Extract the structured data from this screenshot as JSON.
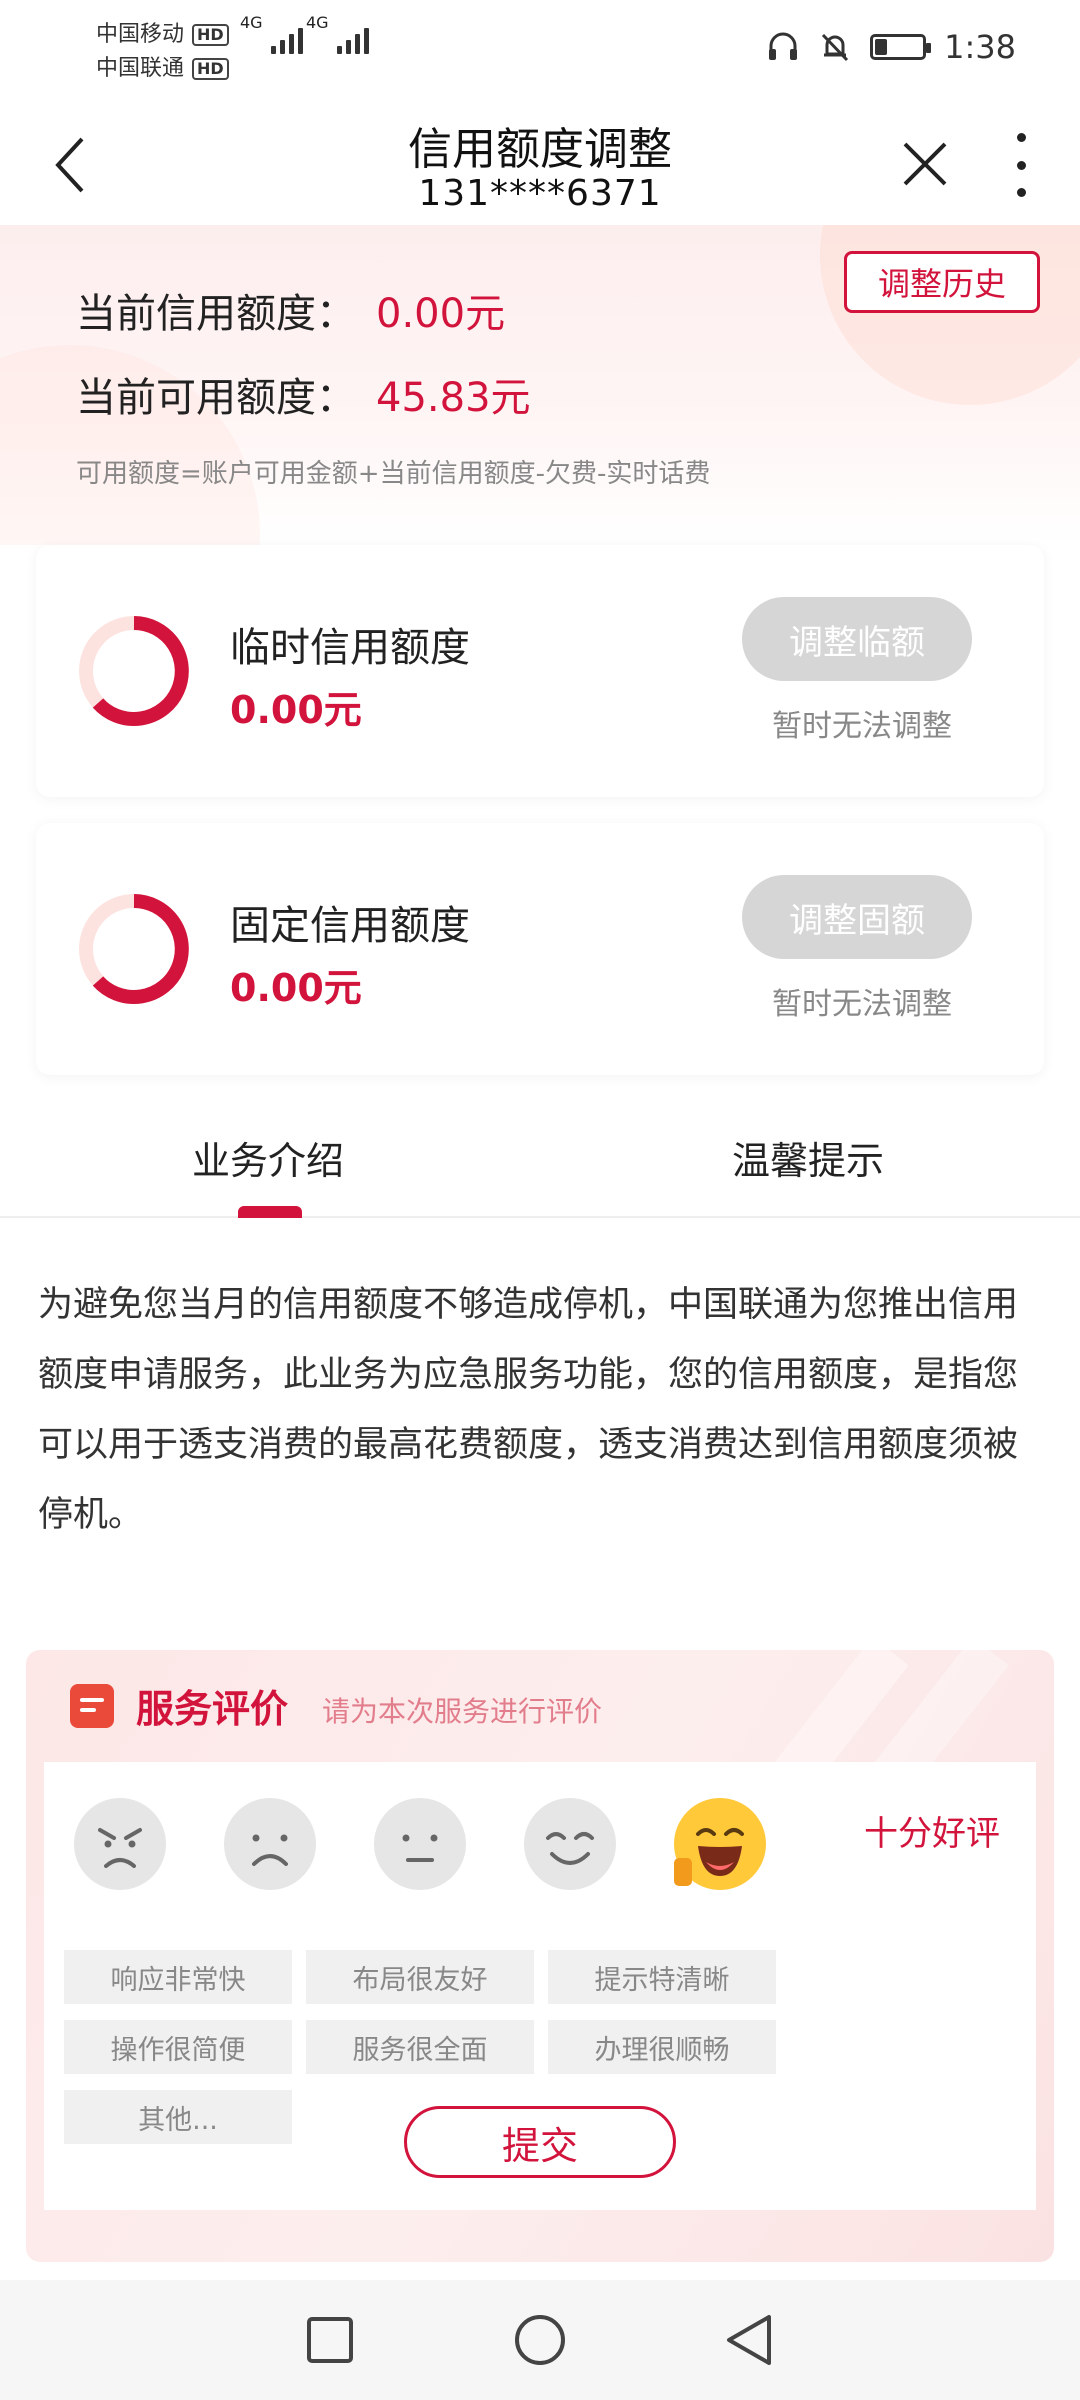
{
  "status_bar": {
    "carrier1": "中国移动",
    "carrier2": "中国联通",
    "hd": "HD",
    "net1": "4G",
    "net2": "4G",
    "time": "1:38",
    "battery_level": 0.25
  },
  "header": {
    "title": "信用额度调整",
    "phone": "131****6371"
  },
  "summary": {
    "history_button": "调整历史",
    "current_credit_label": "当前信用额度：",
    "current_credit_value": "0.00元",
    "current_available_label": "当前可用额度：",
    "current_available_value": "45.83元",
    "formula": "可用额度=账户可用金额+当前信用额度-欠费-实时话费"
  },
  "cards": [
    {
      "label": "临时信用额度",
      "value": "0.00元",
      "button": "调整临额",
      "note": "暂时无法调整"
    },
    {
      "label": "固定信用额度",
      "value": "0.00元",
      "button": "调整固额",
      "note": "暂时无法调整"
    }
  ],
  "tabs": [
    {
      "label": "业务介绍",
      "active": true
    },
    {
      "label": "温馨提示",
      "active": false
    }
  ],
  "intro_text": "为避免您当月的信用额度不够造成停机，中国联通为您推出信用额度申请服务，此业务为应急服务功能，您的信用额度，是指您可以用于透支消费的最高花费额度，透支消费达到信用额度须被停机。",
  "evaluation": {
    "title": "服务评价",
    "hint": "请为本次服务进行评价",
    "selected_rating": 5,
    "rating_text": "十分好评",
    "faces": [
      "angry-face-icon",
      "sad-face-icon",
      "neutral-face-icon",
      "smile-face-icon",
      "laughing-thumbs-up-face-icon"
    ],
    "tags": [
      "响应非常快",
      "布局很友好",
      "提示特清晰",
      "操作很简便",
      "服务很全面",
      "办理很顺畅",
      "其他..."
    ],
    "submit": "提交"
  },
  "colors": {
    "accent": "#d2143c",
    "disabled_button": "#d6d6d6"
  }
}
